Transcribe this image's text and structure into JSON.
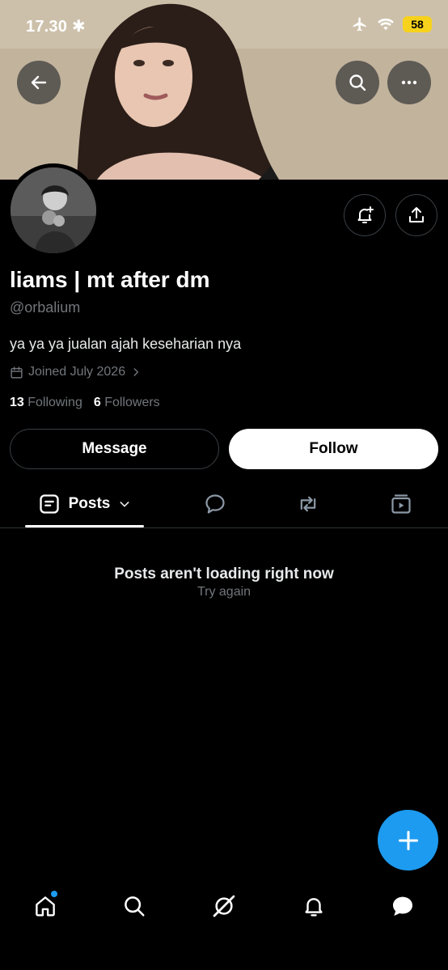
{
  "status_bar": {
    "time": "17.30",
    "battery": "58"
  },
  "profile": {
    "display_name": "liams | mt after dm",
    "handle": "@orbalium",
    "bio": "ya ya ya jualan ajah keseharian nya",
    "joined": "Joined July 2026",
    "following_count": "13",
    "following_label": "Following",
    "followers_count": "6",
    "followers_label": "Followers"
  },
  "actions": {
    "message_label": "Message",
    "follow_label": "Follow"
  },
  "tabs": [
    {
      "label": "Posts",
      "icon": "posts-icon",
      "selected": true
    },
    {
      "label": "",
      "icon": "reply-bubble-icon"
    },
    {
      "label": "",
      "icon": "repost-icon"
    },
    {
      "label": "",
      "icon": "media-icon"
    }
  ],
  "empty_state": {
    "title": "Posts aren't loading right now",
    "retry": "Try again"
  },
  "bottom_nav": [
    "home-icon",
    "search-icon",
    "grok-icon",
    "notifications-icon",
    "messages-icon"
  ],
  "colors": {
    "accent": "#1d9bf0",
    "background": "#000000",
    "battery": "#f7d21c"
  }
}
